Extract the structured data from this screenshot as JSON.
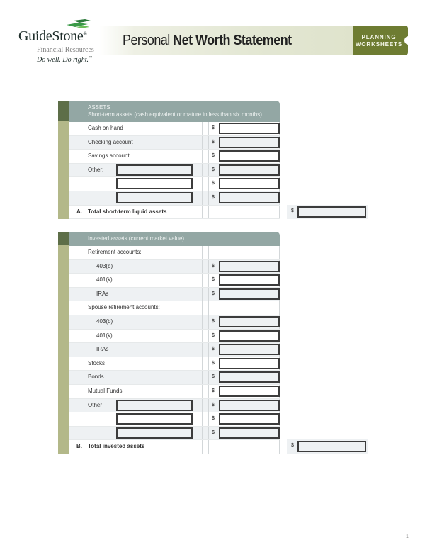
{
  "header": {
    "logo": {
      "name": "GuideStone",
      "registered_mark": "®",
      "subtitle": "Financial Resources",
      "tagline": "Do well. Do right.",
      "tagline_mark": "™"
    },
    "title_light": "Personal ",
    "title_bold": "Net Worth Statement",
    "tab_line1": "PLANNING",
    "tab_line2": "WORKSHEETS"
  },
  "colors": {
    "brand_green": "#6e7c32",
    "section_header": "#93a7a4",
    "header_strip": "#5d6e48",
    "row_strip": "#b3b889",
    "alt_row": "#eef1f3"
  },
  "short_term": {
    "heading": "ASSETS",
    "subheading": "Short-term assets (cash equivalent or mature in less than six months)",
    "currency": "$",
    "rows": [
      {
        "label": "Cash on hand",
        "value": ""
      },
      {
        "label": "Checking account",
        "value": ""
      },
      {
        "label": "Savings account",
        "value": ""
      },
      {
        "label": "Other:",
        "other_text": "",
        "value": ""
      },
      {
        "label": "",
        "other_text": "",
        "value": ""
      },
      {
        "label": "",
        "other_text": "",
        "value": ""
      }
    ],
    "total": {
      "letter": "A.",
      "label": "Total short-term liquid assets",
      "value": ""
    }
  },
  "invested": {
    "heading": "Invested assets (current market value)",
    "currency": "$",
    "rows": [
      {
        "label": "Retirement accounts:"
      },
      {
        "label": "403(b)",
        "value": ""
      },
      {
        "label": "401(k)",
        "value": ""
      },
      {
        "label": "IRAs",
        "value": ""
      },
      {
        "label": "Spouse retirement accounts:"
      },
      {
        "label": "403(b)",
        "value": ""
      },
      {
        "label": "401(k)",
        "value": ""
      },
      {
        "label": "IRAs",
        "value": ""
      },
      {
        "label": "Stocks",
        "value": ""
      },
      {
        "label": "Bonds",
        "value": ""
      },
      {
        "label": "Mutual Funds",
        "value": ""
      },
      {
        "label": "Other",
        "other_text": "",
        "value": ""
      },
      {
        "label": "",
        "other_text": "",
        "value": ""
      },
      {
        "label": "",
        "other_text": "",
        "value": ""
      }
    ],
    "total": {
      "letter": "B.",
      "label": "Total invested assets",
      "value": ""
    }
  },
  "page_number": "1"
}
